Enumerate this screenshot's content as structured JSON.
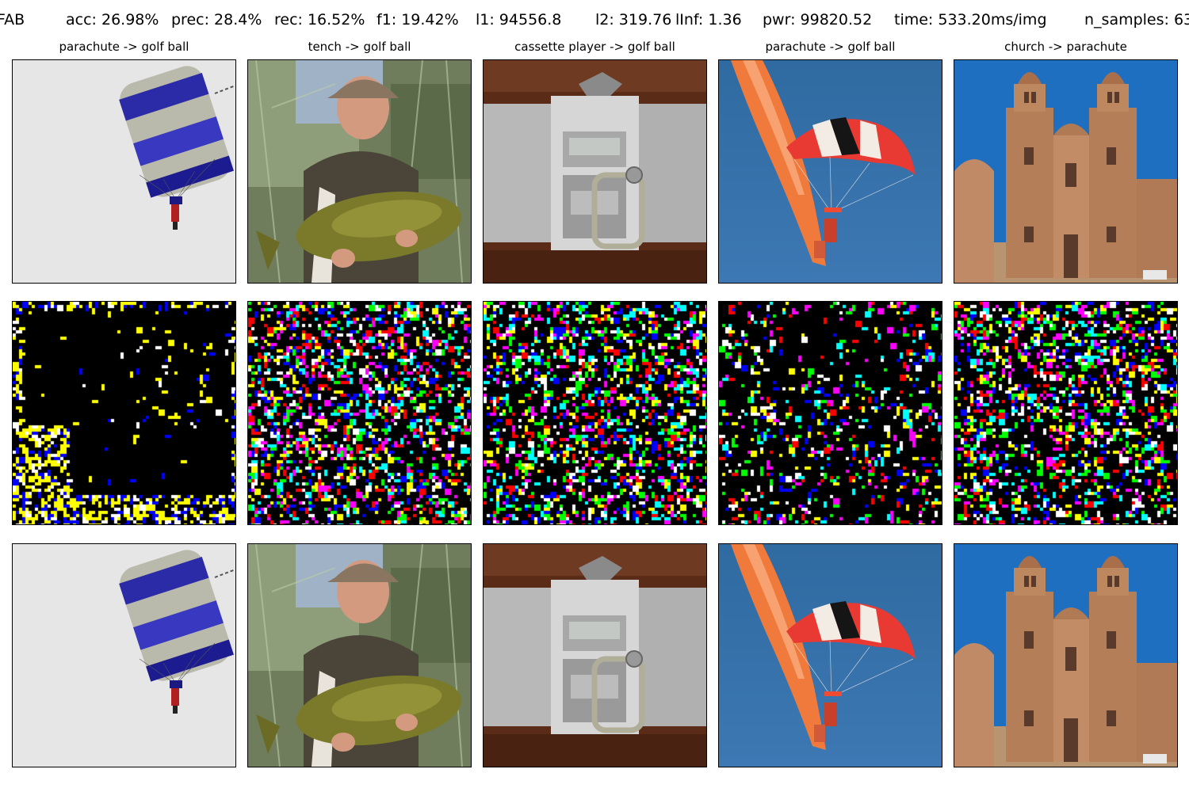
{
  "header": {
    "method": "FAB",
    "acc": "acc: 26.98%",
    "prec": "prec: 28.4%",
    "rec": "rec: 16.52%",
    "f1": "f1: 19.42%",
    "l1": "l1: 94556.8",
    "l2": "l2: 319.76",
    "linf": "lInf: 1.36",
    "pwr": "pwr: 99820.52",
    "time": "time: 533.20ms/img",
    "n_samples": "n_samples: 63"
  },
  "columns": [
    {
      "title": "parachute -> golf ball",
      "scene": "parachute-grey-sky"
    },
    {
      "title": "tench -> golf ball",
      "scene": "man-holding-tench"
    },
    {
      "title": "cassette player -> golf ball",
      "scene": "cassette-player"
    },
    {
      "title": "parachute -> golf ball",
      "scene": "parachute-blue-sky"
    },
    {
      "title": "church -> parachute",
      "scene": "church-facade"
    }
  ],
  "rows": [
    "original",
    "perturbation",
    "adversarial"
  ],
  "colors": {
    "noise": [
      "#ffffff",
      "#ff0000",
      "#00ff00",
      "#0000ff",
      "#ffff00",
      "#ff00ff",
      "#00ffff"
    ]
  }
}
